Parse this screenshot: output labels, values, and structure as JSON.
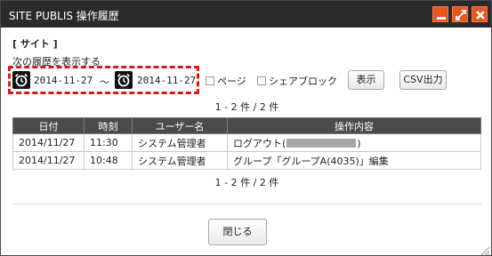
{
  "window": {
    "title": "SITE PUBLIS 操作履歴"
  },
  "filters": {
    "section_title": "[ サイト ]",
    "date_label": "次の履歴を表示する",
    "date_from": "2014-11-27",
    "separator": "～",
    "date_to": "2014-11-27",
    "checkbox_page": "ページ",
    "checkbox_share_block": "シェアブロック",
    "show_button": "表示",
    "csv_button": "CSV出力"
  },
  "pager": {
    "top": "1 - 2 件 / 2 件",
    "bottom": "1 - 2 件 / 2 件"
  },
  "table": {
    "headers": [
      "日付",
      "時刻",
      "ユーザー名",
      "操作内容"
    ],
    "rows": [
      {
        "date": "2014/11/27",
        "time": "11:30",
        "user": "システム管理者",
        "op_prefix": "ログアウト(",
        "op_suffix": ")"
      },
      {
        "date": "2014/11/27",
        "time": "10:48",
        "user": "システム管理者",
        "op_prefix": "グループ「グループA(4035)」編集",
        "op_suffix": ""
      }
    ]
  },
  "footer": {
    "close_button": "閉じる"
  },
  "colors": {
    "titlebar": "#2b2b2b",
    "window_buttons": "#e8561d",
    "highlight_dashed": "#e4141b",
    "table_header": "#4b4b4b"
  },
  "icons": [
    "minimize-icon",
    "maximize-icon",
    "close-icon",
    "alarm-clock-icon"
  ]
}
